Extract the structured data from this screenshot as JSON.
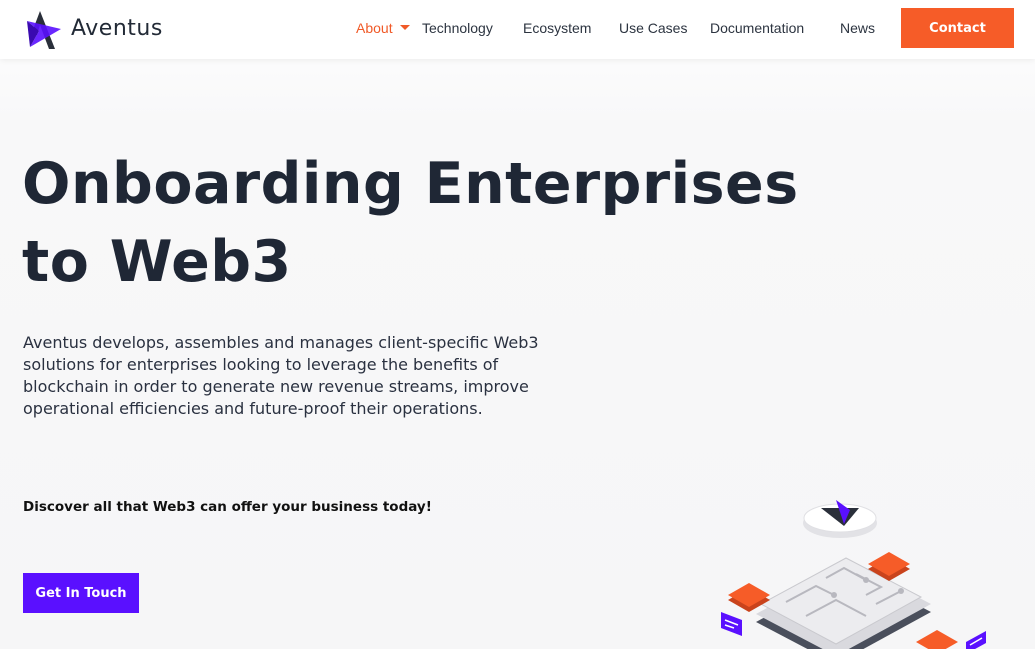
{
  "brand": {
    "name": "Aventus",
    "colors": {
      "accent_orange": "#f65c28",
      "accent_purple": "#5a10ff",
      "text_dark": "#1f2735"
    }
  },
  "nav": {
    "items": [
      {
        "label": "About",
        "active": true,
        "has_dropdown": true,
        "icon": "caret-down-icon"
      },
      {
        "label": "Technology"
      },
      {
        "label": "Ecosystem"
      },
      {
        "label": "Use Cases"
      },
      {
        "label": "Documentation"
      },
      {
        "label": "News"
      }
    ],
    "contact_label": "Contact"
  },
  "hero": {
    "title_line1": "Onboarding Enterprises",
    "title_line2": "to Web3",
    "body": "Aventus develops, assembles and manages client-specific Web3 solutions for enterprises looking to leverage the benefits of blockchain in order to generate new revenue streams, improve operational efficiencies and future-proof their operations.",
    "discover": "Discover all that Web3 can offer your business today!",
    "cta_label": "Get In Touch"
  },
  "illustration": {
    "icon": "isometric-blockchain-chip-illustration"
  }
}
